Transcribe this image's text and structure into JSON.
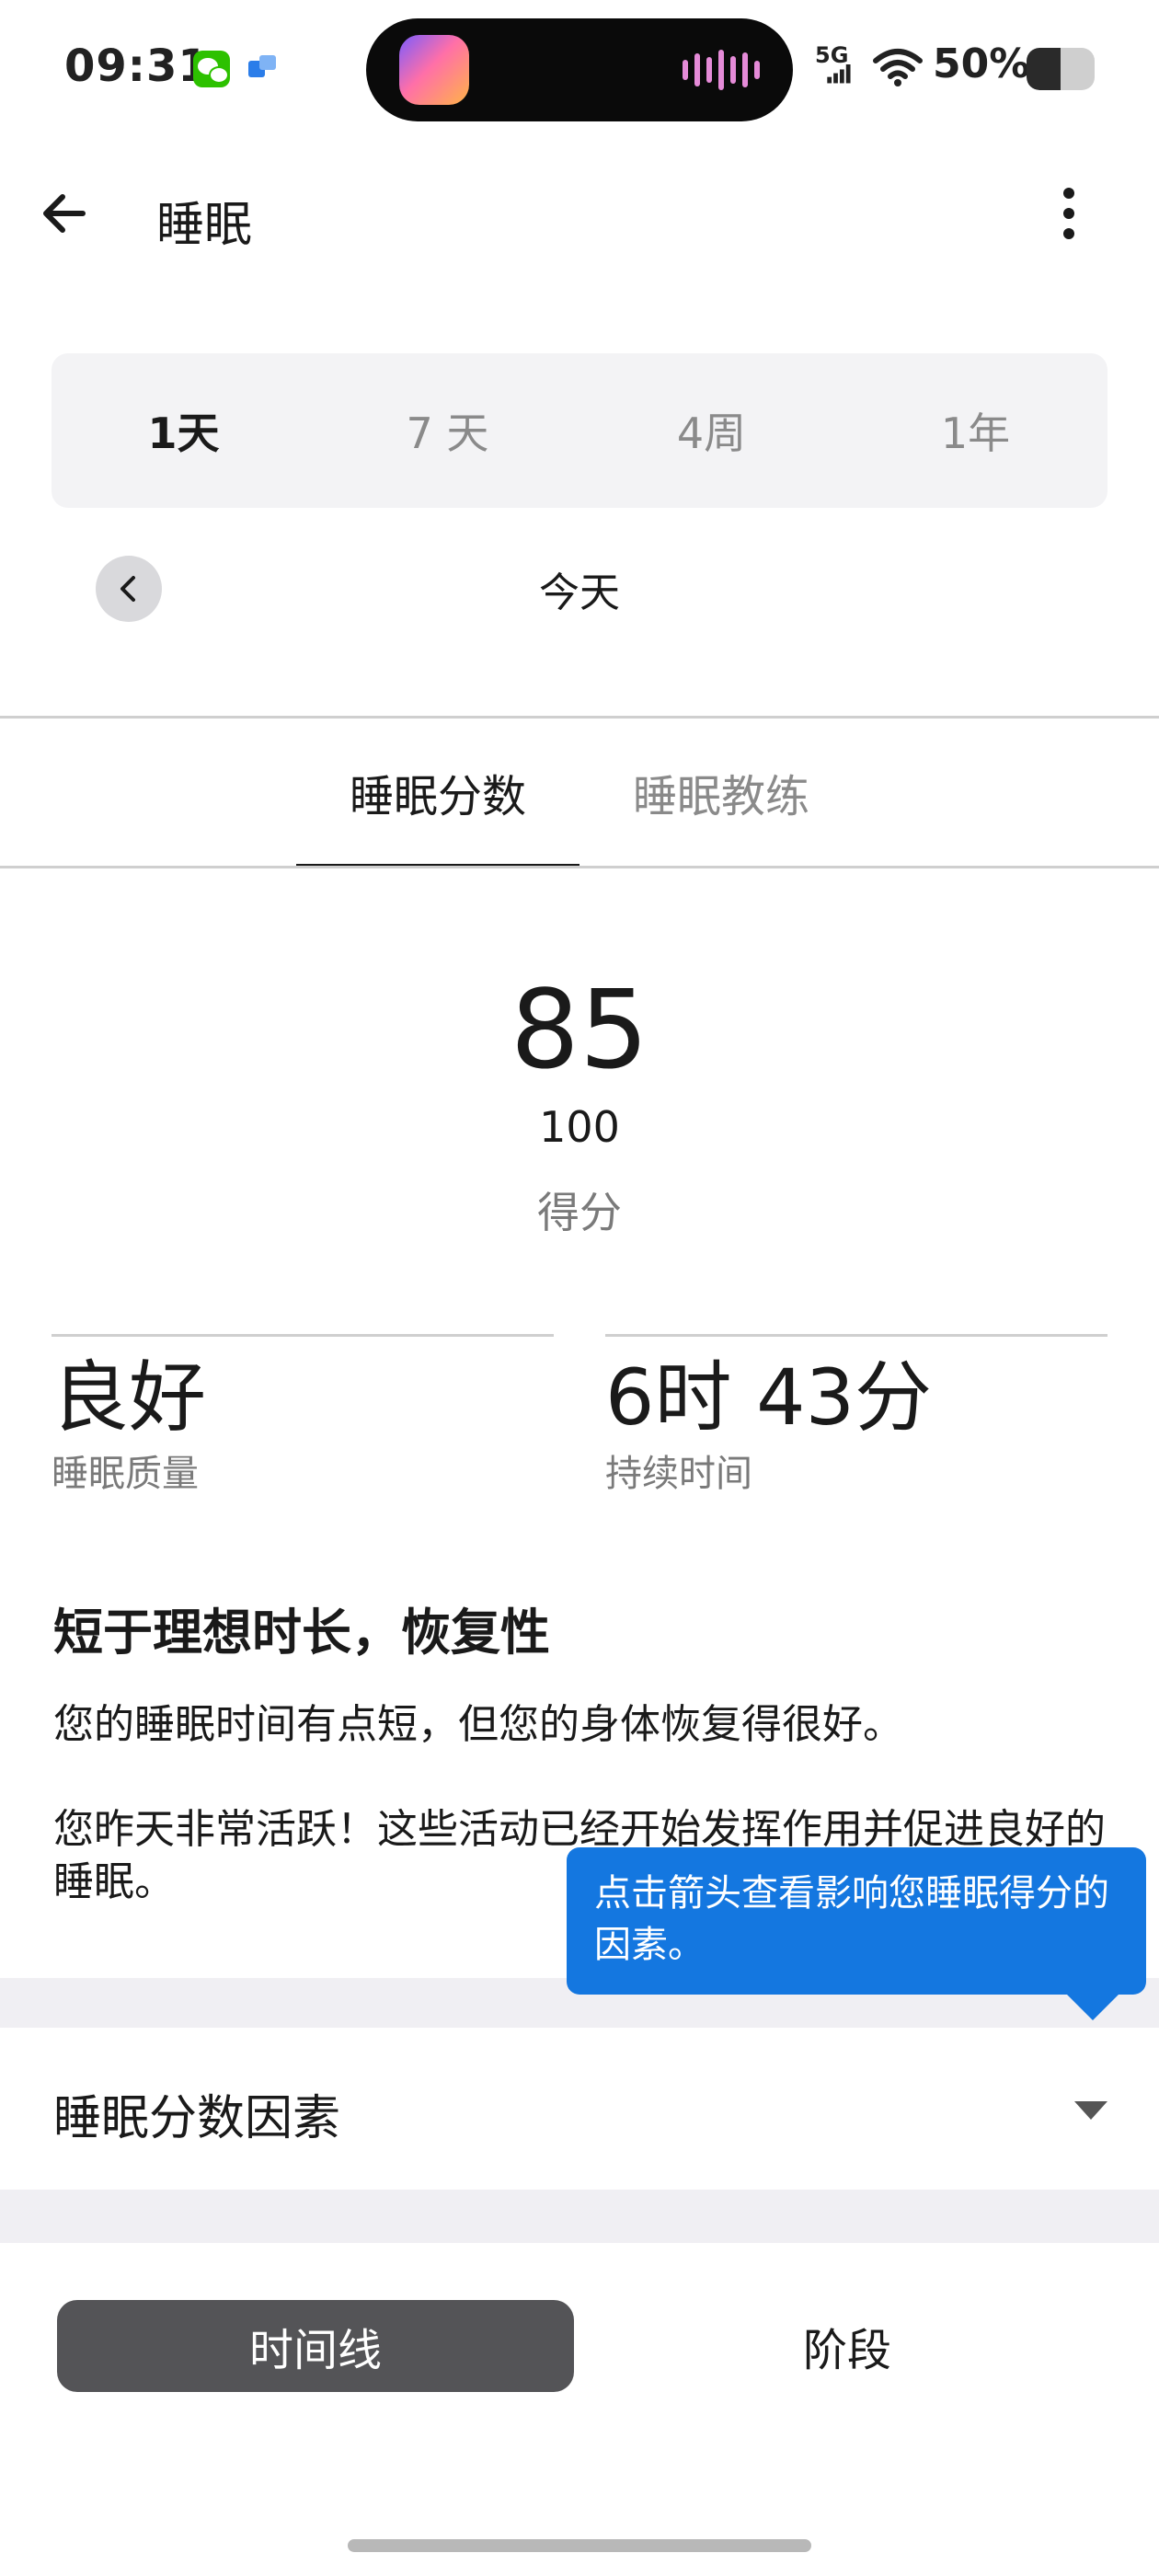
{
  "status_bar": {
    "time": "09:31",
    "network": "5G",
    "battery": "50%",
    "battery_level": 0.5,
    "icons": [
      "wechat-icon",
      "app-notification-icon",
      "signal-icon",
      "wifi-icon",
      "battery-icon"
    ]
  },
  "app_bar": {
    "title": "睡眠",
    "back_icon": "arrow-left-icon",
    "more_icon": "more-vertical-icon"
  },
  "range_tabs": [
    {
      "label": "1天",
      "active": true
    },
    {
      "label": "7 天",
      "active": false
    },
    {
      "label": "4周",
      "active": false
    },
    {
      "label": "1年",
      "active": false
    }
  ],
  "date_nav": {
    "label": "今天",
    "prev_icon": "chevron-left-icon"
  },
  "tabs": [
    {
      "label": "睡眠分数",
      "active": true
    },
    {
      "label": "睡眠教练",
      "active": false
    }
  ],
  "score": {
    "value": "85",
    "max": "100",
    "label": "得分"
  },
  "stats": {
    "quality": {
      "value": "良好",
      "caption": "睡眠质量"
    },
    "duration": {
      "value": "6时 43分",
      "caption": "持续时间"
    }
  },
  "insight": {
    "title": "短于理想时长，恢复性",
    "paragraph1": "您的睡眠时间有点短，但您的身体恢复得很好。",
    "paragraph2": "您昨天非常活跃！这些活动已经开始发挥作用并促进良好的睡眠。"
  },
  "tooltip": {
    "text": "点击箭头查看影响您睡眠得分的因素。"
  },
  "factors": {
    "label": "睡眠分数因素",
    "chevron_icon": "chevron-down-icon"
  },
  "view_toggle": {
    "timeline": "时间线",
    "stages": "阶段",
    "selected": "时间线"
  },
  "colors": {
    "accent_blue": "#1477e0",
    "toggle_selected": "#545457",
    "range_bg": "#f3f3f5"
  }
}
